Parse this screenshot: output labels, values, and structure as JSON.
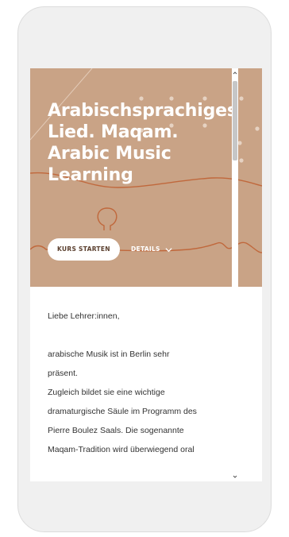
{
  "hero": {
    "title_lines": [
      "Arabischsprachiges",
      "Lied. Maqam.",
      "Arabic Music",
      "Learning"
    ],
    "start_label": "KURS STARTEN",
    "details_label": "DETAILS"
  },
  "content": {
    "paragraphs": [
      "Liebe Lehrer:innen,",
      "",
      "arabische Musik ist in Berlin sehr",
      "präsent.",
      "Zugleich bildet sie eine wichtige",
      "dramaturgische Säule im Programm des",
      "Pierre Boulez Saals. Die sogenannte",
      "Maqam-Tradition wird überwiegend oral"
    ]
  },
  "colors": {
    "hero_bg": "#c9a386",
    "accent_line": "#c0683c"
  },
  "icons": [
    "chevron-down-icon",
    "scroll-up-arrow-icon",
    "scroll-down-arrow-icon"
  ]
}
